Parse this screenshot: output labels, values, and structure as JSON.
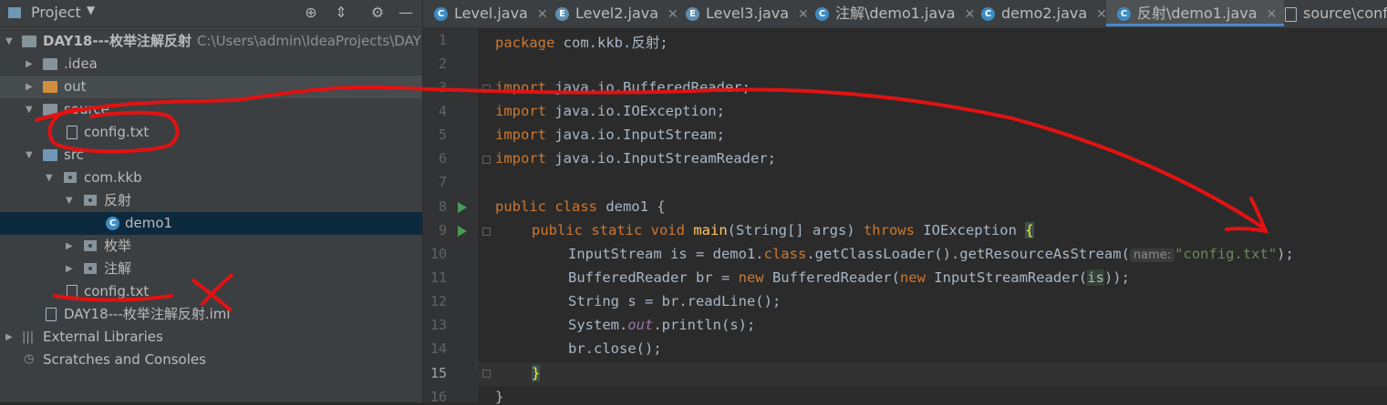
{
  "project_panel": {
    "title": "Project",
    "tree": [
      {
        "label": "DAY18---枚举注解反射",
        "path": "C:\\Users\\admin\\IdeaProjects\\DAY"
      },
      {
        "label": ".idea"
      },
      {
        "label": "out"
      },
      {
        "label": "source"
      },
      {
        "label": "config.txt"
      },
      {
        "label": "src"
      },
      {
        "label": "com.kkb"
      },
      {
        "label": "反射"
      },
      {
        "label": "demo1"
      },
      {
        "label": "枚举"
      },
      {
        "label": "注解"
      },
      {
        "label": "config.txt"
      },
      {
        "label": "DAY18---枚举注解反射.iml"
      },
      {
        "label": "External Libraries"
      },
      {
        "label": "Scratches and Consoles"
      }
    ]
  },
  "tabs": [
    {
      "label": "Level.java",
      "icon": "C"
    },
    {
      "label": "Level2.java",
      "icon": "E"
    },
    {
      "label": "Level3.java",
      "icon": "E"
    },
    {
      "label": "注解\\demo1.java",
      "icon": "C"
    },
    {
      "label": "demo2.java",
      "icon": "C"
    },
    {
      "label": "反射\\demo1.java",
      "icon": "C"
    },
    {
      "label": "source\\confi",
      "icon": "file"
    }
  ],
  "editor": {
    "line_numbers": [
      "1",
      "2",
      "3",
      "4",
      "5",
      "6",
      "7",
      "8",
      "9",
      "10",
      "11",
      "12",
      "13",
      "14",
      "15",
      "16"
    ],
    "line1": {
      "kw": "package",
      "rest": " com.kkb.反射;"
    },
    "imports": [
      {
        "kw": "import",
        "rest": " java.io.BufferedReader;"
      },
      {
        "kw": "import",
        "rest": " java.io.IOException;"
      },
      {
        "kw": "import",
        "rest": " java.io.InputStream;"
      },
      {
        "kw": "import",
        "rest": " java.io.InputStreamReader;"
      }
    ],
    "line8": {
      "kw": "public class",
      "rest": " demo1 {"
    },
    "line9": {
      "kw1": "public static void",
      "fn": "main",
      "mid": "(String[] args) ",
      "kw2": "throws",
      "rest": " IOException ",
      "brace": "{"
    },
    "line10": {
      "a": "InputStream is = demo1.",
      "kw": "class",
      "b": ".getClassLoader().getResourceAsStream(",
      "hint": "name:",
      "str": "\"config.txt\"",
      "c": ");"
    },
    "line11": {
      "a": "BufferedReader br = ",
      "kw1": "new",
      "b": " BufferedReader(",
      "kw2": "new",
      "c": " InputStreamReader(",
      "is": "is",
      "d": "));"
    },
    "line12": {
      "a": "String s = br.readLine();"
    },
    "line13": {
      "a": "System.",
      "st": "out",
      "b": ".println(s);"
    },
    "line14": {
      "a": "br.close();"
    },
    "line15": {
      "brace": "}"
    },
    "line16": {
      "a": "}"
    }
  }
}
